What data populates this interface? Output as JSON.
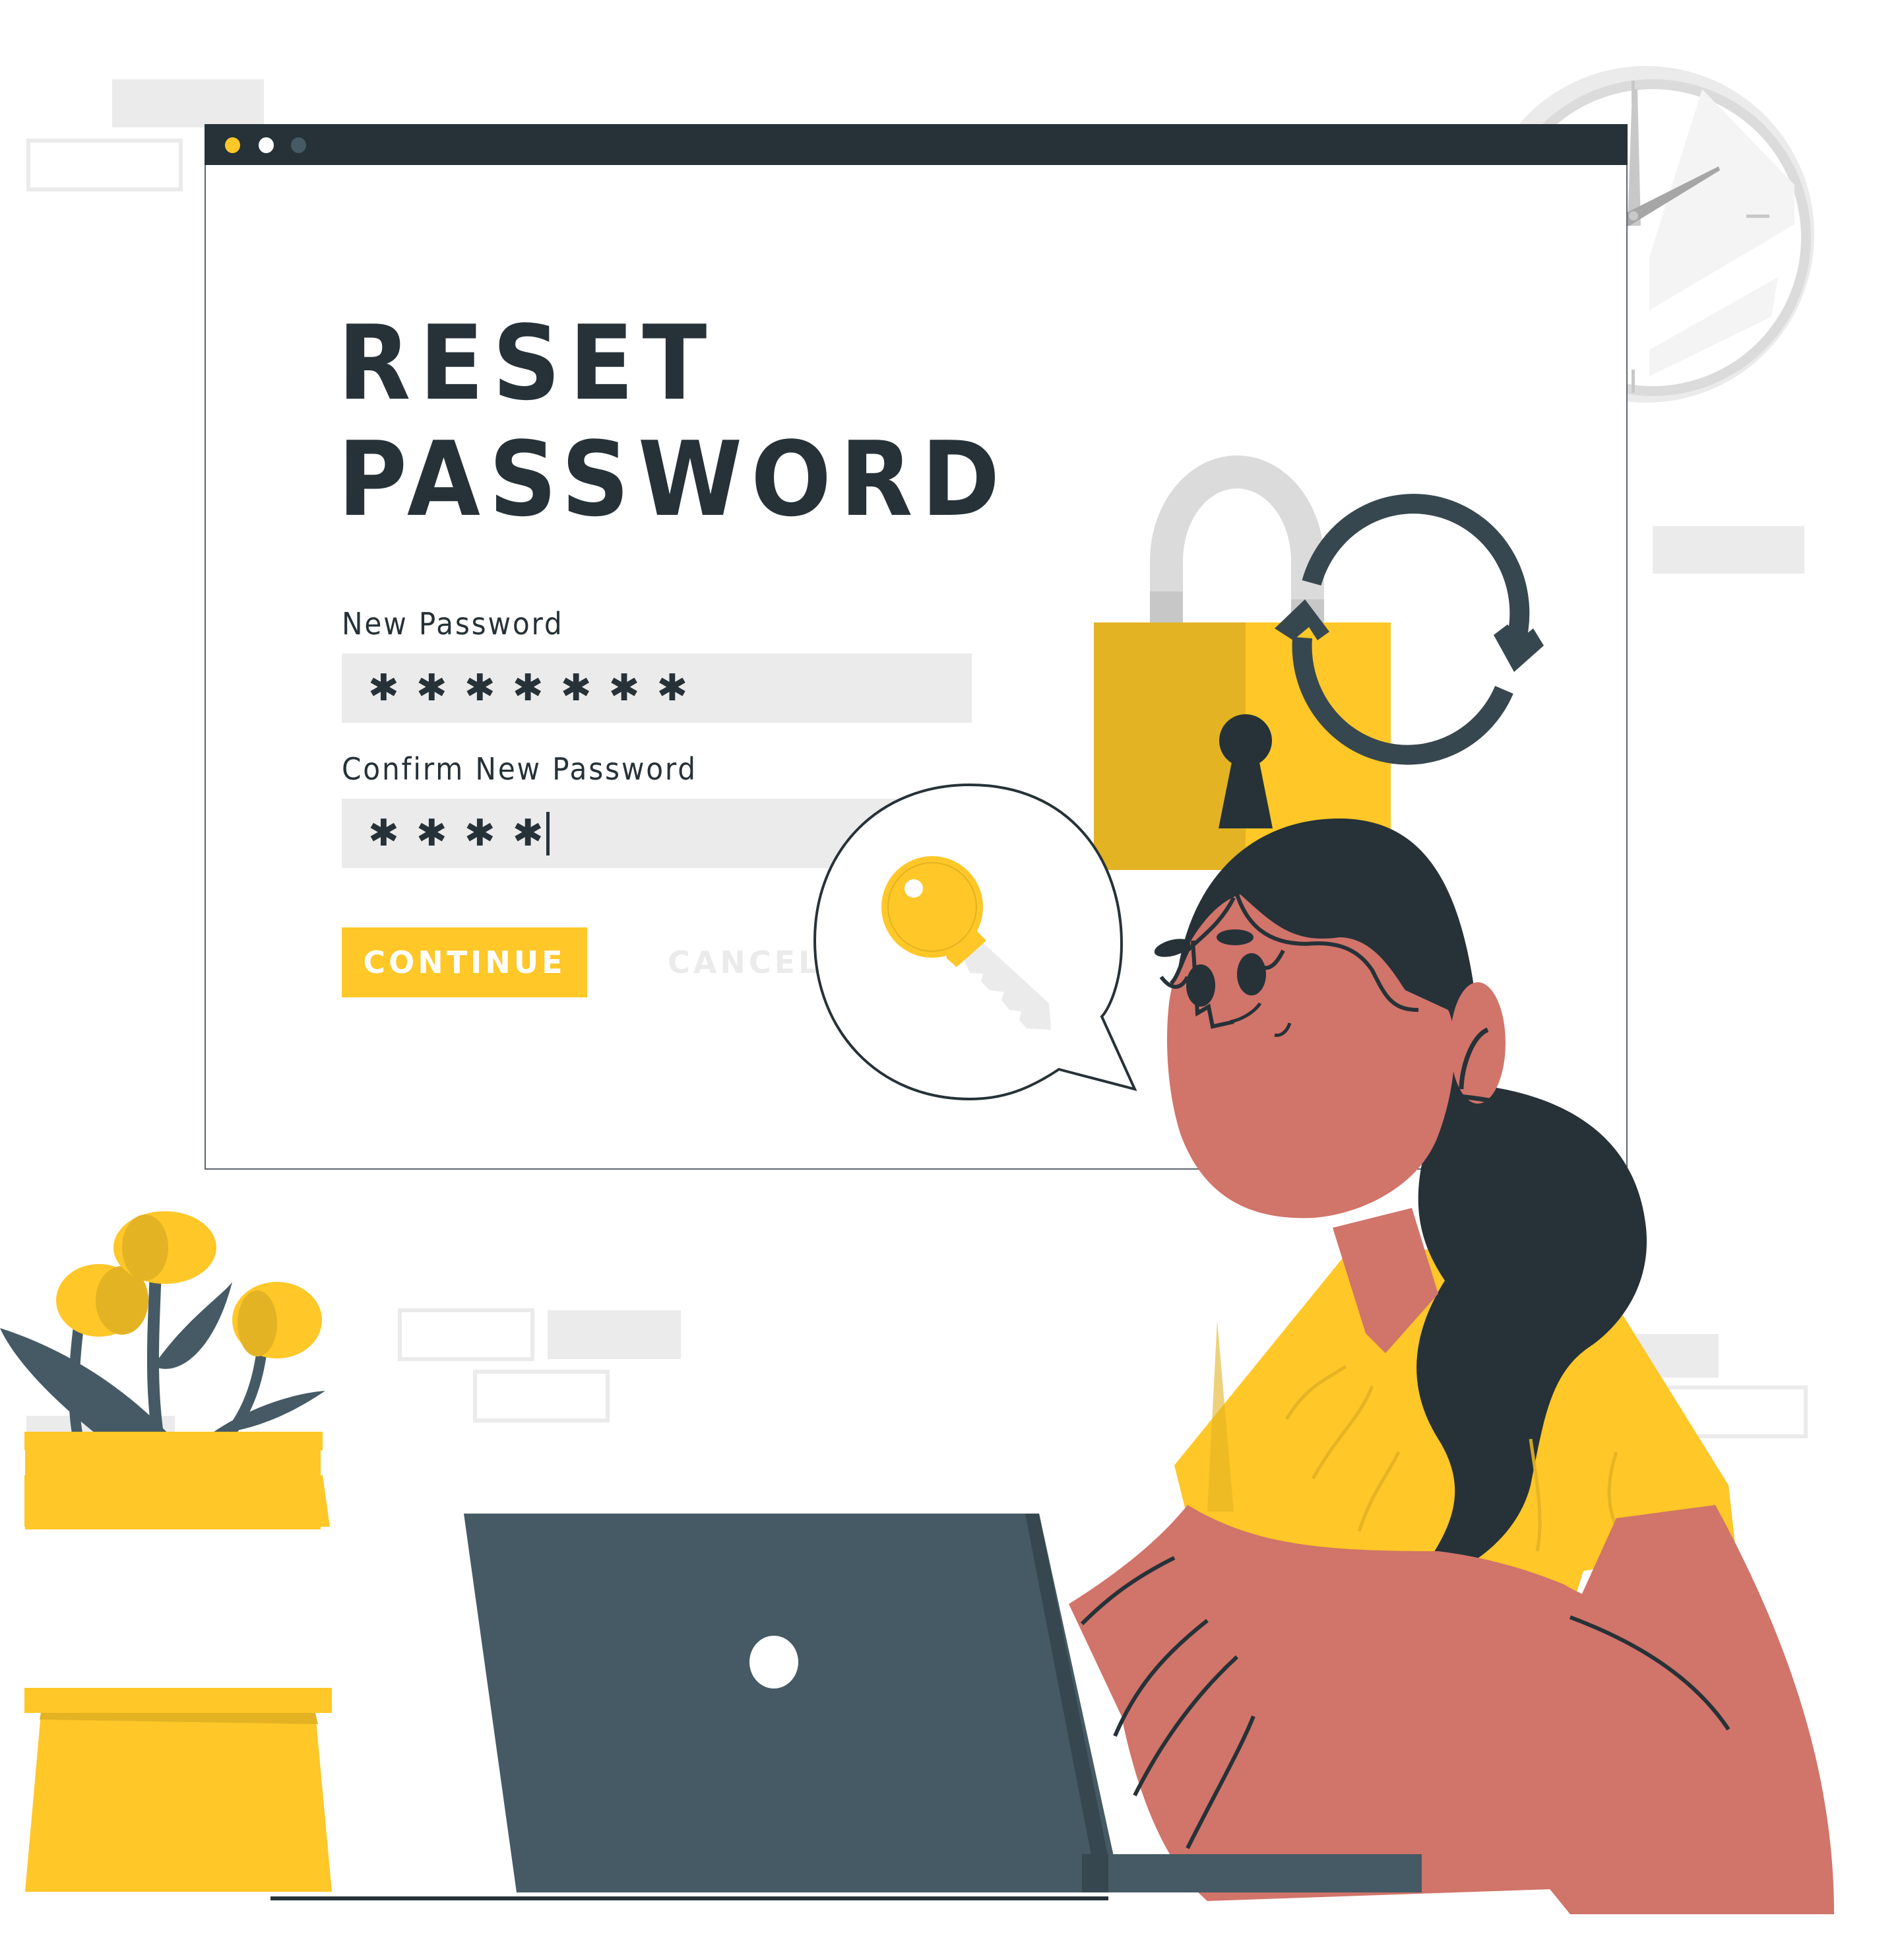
{
  "window": {
    "controls": [
      {
        "name": "window-dot-yellow",
        "color": "#ffc727"
      },
      {
        "name": "window-dot-white",
        "color": "#ffffff"
      },
      {
        "name": "window-dot-gray",
        "color": "#455a64"
      }
    ]
  },
  "form": {
    "title_line1": "RESET",
    "title_line2": "PASSWORD",
    "new_password": {
      "label": "New Password",
      "value": "✱✱✱✱✱✱✱"
    },
    "confirm_password": {
      "label": "Confirm New Password",
      "value": "✱✱✱✱"
    },
    "continue_label": "CONTINUE",
    "cancel_label": "CANCEL"
  },
  "illustration": {
    "icons": [
      "padlock-icon",
      "refresh-icon",
      "key-icon",
      "speech-bubble-icon",
      "wall-clock-icon",
      "laptop-icon",
      "tulip-plant-icon",
      "person-illustration"
    ]
  },
  "colors": {
    "accent_yellow": "#ffc727",
    "accent_yellow_dark": "#e3b324",
    "dark": "#263238",
    "slate": "#455a64",
    "light_gray": "#ebebeb",
    "skin": "#d1746a"
  }
}
